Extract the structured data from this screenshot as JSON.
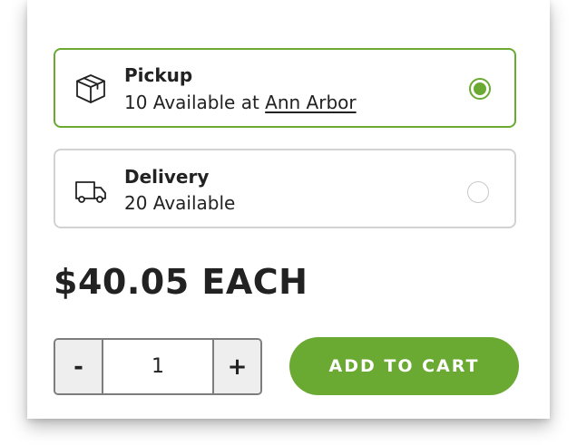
{
  "fulfillment": {
    "options": [
      {
        "id": "pickup",
        "icon": "box-icon",
        "title": "Pickup",
        "availability_prefix": "10 Available at ",
        "store_link": "Ann Arbor",
        "selected": true
      },
      {
        "id": "delivery",
        "icon": "truck-icon",
        "title": "Delivery",
        "availability": "20 Available",
        "selected": false
      }
    ]
  },
  "price": {
    "label": "$40.05 EACH"
  },
  "quantity": {
    "decrement_label": "-",
    "value": "1",
    "increment_label": "+"
  },
  "actions": {
    "add_to_cart_label": "ADD TO CART"
  },
  "colors": {
    "accent": "#6aaa33",
    "text": "#222222",
    "border_unselected": "#d2d2d2",
    "stepper_border": "#7d7d7d",
    "stepper_bg": "#eeeeee"
  }
}
